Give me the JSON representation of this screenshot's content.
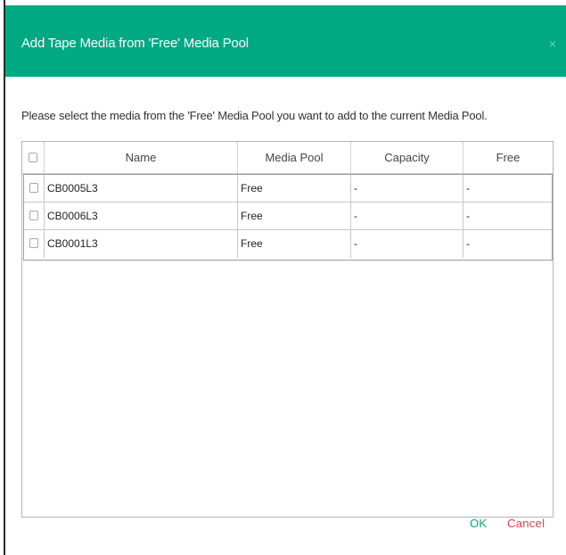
{
  "dialog": {
    "title": "Add Tape Media from 'Free' Media Pool",
    "close_symbol": "×",
    "instruction": "Please select the media from the 'Free' Media Pool you want to add to the current Media Pool."
  },
  "table": {
    "columns": [
      "Name",
      "Media Pool",
      "Capacity",
      "Free"
    ],
    "rows": [
      {
        "name": "CB0005L3",
        "media_pool": "Free",
        "capacity": "-",
        "free": "-"
      },
      {
        "name": "CB0006L3",
        "media_pool": "Free",
        "capacity": "-",
        "free": "-"
      },
      {
        "name": "CB0001L3",
        "media_pool": "Free",
        "capacity": "-",
        "free": "-"
      }
    ]
  },
  "buttons": {
    "ok": "OK",
    "cancel": "Cancel"
  },
  "colors": {
    "header_bg": "#01a982",
    "ok": "#01a982",
    "cancel": "#e63e4c"
  }
}
